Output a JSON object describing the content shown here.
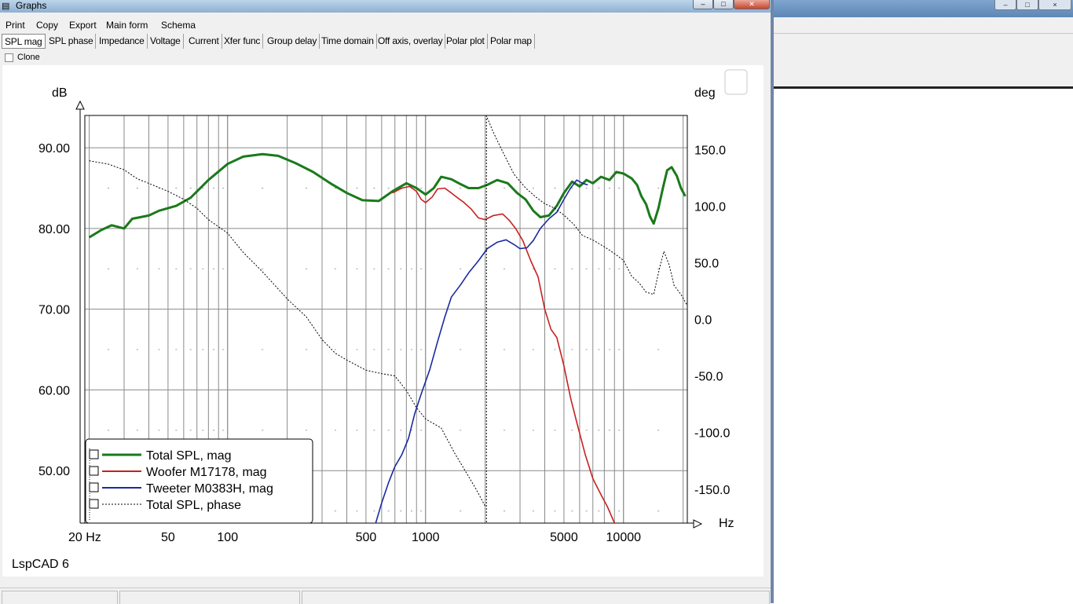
{
  "window": {
    "title": "Graphs",
    "menu": [
      "Print",
      "Copy",
      "Export",
      "Main form",
      "Schema"
    ],
    "tabs": [
      "SPL mag",
      "SPL phase",
      "Impedance",
      "Voltage",
      "Current",
      "Xfer func",
      "Group delay",
      "Time domain",
      "Off axis, overlay",
      "Polar plot",
      "Polar map"
    ],
    "active_tab": "SPL mag",
    "clone_label": "Clone",
    "watermark": "LspCAD 6"
  },
  "chart_data": {
    "type": "line",
    "xscale": "log",
    "xlim": [
      19,
      21000
    ],
    "ylim": [
      43.5,
      94
    ],
    "y2lim": [
      -180,
      180
    ],
    "left_unit": "dB",
    "right_unit": "deg",
    "x_unit": "Hz",
    "x_ticks": [
      {
        "v": 20,
        "label": "20 Hz"
      },
      {
        "v": 50,
        "label": "50"
      },
      {
        "v": 100,
        "label": "100"
      },
      {
        "v": 500,
        "label": "500"
      },
      {
        "v": 1000,
        "label": "1000"
      },
      {
        "v": 5000,
        "label": "5000"
      },
      {
        "v": 10000,
        "label": "10000"
      }
    ],
    "y_ticks": [
      {
        "v": 90,
        "label": "90.00"
      },
      {
        "v": 80,
        "label": "80.00"
      },
      {
        "v": 70,
        "label": "70.00"
      },
      {
        "v": 60,
        "label": "60.00"
      },
      {
        "v": 50,
        "label": "50.00"
      }
    ],
    "y2_ticks": [
      {
        "v": 150,
        "label": "150.0"
      },
      {
        "v": 100,
        "label": "100.0"
      },
      {
        "v": 50,
        "label": "50.0"
      },
      {
        "v": 0,
        "label": "0.0"
      },
      {
        "v": -50,
        "label": "-50.0"
      },
      {
        "v": -100,
        "label": "-100.0"
      },
      {
        "v": -150,
        "label": "-150.0"
      }
    ],
    "grid": true,
    "legend_position": "bottom-left",
    "series": [
      {
        "name": "Total SPL, mag",
        "color": "#1a7a1a",
        "axis": "left",
        "dash": false,
        "points": [
          [
            20,
            78.9
          ],
          [
            23,
            79.8
          ],
          [
            26,
            80.4
          ],
          [
            30,
            80.0
          ],
          [
            33,
            81.2
          ],
          [
            40,
            81.6
          ],
          [
            45,
            82.2
          ],
          [
            55,
            82.8
          ],
          [
            65,
            83.8
          ],
          [
            80,
            86.0
          ],
          [
            100,
            88.0
          ],
          [
            120,
            88.9
          ],
          [
            150,
            89.2
          ],
          [
            180,
            89.0
          ],
          [
            220,
            88.1
          ],
          [
            270,
            87.0
          ],
          [
            330,
            85.6
          ],
          [
            400,
            84.4
          ],
          [
            480,
            83.5
          ],
          [
            580,
            83.4
          ],
          [
            680,
            84.6
          ],
          [
            800,
            85.6
          ],
          [
            900,
            85.0
          ],
          [
            1000,
            84.2
          ],
          [
            1100,
            85.0
          ],
          [
            1200,
            86.4
          ],
          [
            1350,
            86.1
          ],
          [
            1500,
            85.5
          ],
          [
            1650,
            85.0
          ],
          [
            1850,
            85.0
          ],
          [
            2050,
            85.4
          ],
          [
            2300,
            86.0
          ],
          [
            2600,
            85.6
          ],
          [
            2900,
            84.4
          ],
          [
            3200,
            83.6
          ],
          [
            3500,
            82.2
          ],
          [
            3800,
            81.4
          ],
          [
            4200,
            81.6
          ],
          [
            4600,
            82.8
          ],
          [
            5000,
            84.4
          ],
          [
            5500,
            85.8
          ],
          [
            6000,
            85.2
          ],
          [
            6500,
            86.0
          ],
          [
            7000,
            85.6
          ],
          [
            7700,
            86.4
          ],
          [
            8500,
            86.0
          ],
          [
            9200,
            87.0
          ],
          [
            10000,
            86.8
          ],
          [
            11000,
            86.2
          ],
          [
            11700,
            85.4
          ],
          [
            12300,
            84.0
          ],
          [
            13000,
            83.0
          ],
          [
            13600,
            81.5
          ],
          [
            14200,
            80.6
          ],
          [
            15000,
            82.5
          ],
          [
            15800,
            85.0
          ],
          [
            16600,
            87.2
          ],
          [
            17500,
            87.6
          ],
          [
            18600,
            86.5
          ],
          [
            19500,
            85.0
          ],
          [
            20500,
            84.0
          ]
        ]
      },
      {
        "name": "Woofer M17178, mag",
        "color": "#c82020",
        "axis": "left",
        "dash": false,
        "points": [
          [
            680,
            84.4
          ],
          [
            760,
            85.0
          ],
          [
            830,
            85.2
          ],
          [
            900,
            84.6
          ],
          [
            950,
            83.6
          ],
          [
            1000,
            83.2
          ],
          [
            1080,
            83.9
          ],
          [
            1150,
            84.9
          ],
          [
            1250,
            85.0
          ],
          [
            1350,
            84.4
          ],
          [
            1450,
            83.8
          ],
          [
            1550,
            83.3
          ],
          [
            1700,
            82.4
          ],
          [
            1850,
            81.3
          ],
          [
            2000,
            81.1
          ],
          [
            2200,
            81.6
          ],
          [
            2450,
            81.8
          ],
          [
            2650,
            81.0
          ],
          [
            2850,
            80.0
          ],
          [
            3100,
            78.5
          ],
          [
            3400,
            76.0
          ],
          [
            3700,
            74.0
          ],
          [
            4000,
            70.0
          ],
          [
            4300,
            67.5
          ],
          [
            4600,
            66.5
          ],
          [
            5000,
            63.0
          ],
          [
            5400,
            59.0
          ],
          [
            5800,
            56.0
          ],
          [
            6400,
            52.0
          ],
          [
            7000,
            49.0
          ],
          [
            7700,
            47.0
          ],
          [
            8300,
            45.5
          ],
          [
            9000,
            43.5
          ]
        ]
      },
      {
        "name": "Tweeter M0383H, mag",
        "color": "#1a2aa0",
        "axis": "left",
        "dash": false,
        "points": [
          [
            560,
            43.5
          ],
          [
            600,
            46.0
          ],
          [
            650,
            48.5
          ],
          [
            700,
            50.5
          ],
          [
            760,
            52.0
          ],
          [
            820,
            54.0
          ],
          [
            880,
            57.0
          ],
          [
            950,
            59.5
          ],
          [
            1050,
            62.5
          ],
          [
            1150,
            66.0
          ],
          [
            1250,
            69.0
          ],
          [
            1350,
            71.5
          ],
          [
            1500,
            73.0
          ],
          [
            1650,
            74.5
          ],
          [
            1850,
            76.0
          ],
          [
            2050,
            77.5
          ],
          [
            2300,
            78.3
          ],
          [
            2550,
            78.6
          ],
          [
            2800,
            78.0
          ],
          [
            3000,
            77.5
          ],
          [
            3250,
            77.6
          ],
          [
            3500,
            78.5
          ],
          [
            3800,
            80.0
          ],
          [
            4200,
            81.2
          ],
          [
            4600,
            82.0
          ],
          [
            5000,
            83.6
          ],
          [
            5400,
            85.0
          ],
          [
            5800,
            86.0
          ],
          [
            6200,
            85.6
          ],
          [
            6600,
            85.4
          ]
        ]
      },
      {
        "name": "Total SPL, phase",
        "color": "#000000",
        "axis": "right",
        "dash": true,
        "points": [
          [
            20,
            140
          ],
          [
            25,
            137
          ],
          [
            30,
            132
          ],
          [
            35,
            124
          ],
          [
            40,
            120
          ],
          [
            50,
            113
          ],
          [
            60,
            106
          ],
          [
            70,
            98
          ],
          [
            80,
            88
          ],
          [
            100,
            76
          ],
          [
            120,
            59
          ],
          [
            150,
            42
          ],
          [
            200,
            18
          ],
          [
            250,
            2
          ],
          [
            300,
            -18
          ],
          [
            350,
            -30
          ],
          [
            400,
            -36
          ],
          [
            500,
            -45
          ],
          [
            600,
            -48
          ],
          [
            700,
            -50
          ],
          [
            800,
            -63
          ],
          [
            900,
            -78
          ],
          [
            1000,
            -88
          ],
          [
            1200,
            -96
          ],
          [
            1400,
            -118
          ],
          [
            1600,
            -135
          ],
          [
            1800,
            -150
          ],
          [
            2000,
            -165
          ],
          [
            2050,
            178
          ],
          [
            2200,
            165
          ],
          [
            2500,
            145
          ],
          [
            2800,
            128
          ],
          [
            3200,
            116
          ],
          [
            3600,
            108
          ],
          [
            4000,
            102
          ],
          [
            4500,
            98
          ],
          [
            5000,
            92
          ],
          [
            5600,
            84
          ],
          [
            6200,
            74
          ],
          [
            7000,
            70
          ],
          [
            8000,
            64
          ],
          [
            9000,
            58
          ],
          [
            10000,
            52
          ],
          [
            11000,
            38
          ],
          [
            12000,
            32
          ],
          [
            13000,
            24
          ],
          [
            14200,
            22
          ],
          [
            15200,
            45
          ],
          [
            16000,
            60
          ],
          [
            17000,
            48
          ],
          [
            18000,
            30
          ],
          [
            19500,
            22
          ],
          [
            21000,
            12
          ]
        ]
      }
    ]
  }
}
